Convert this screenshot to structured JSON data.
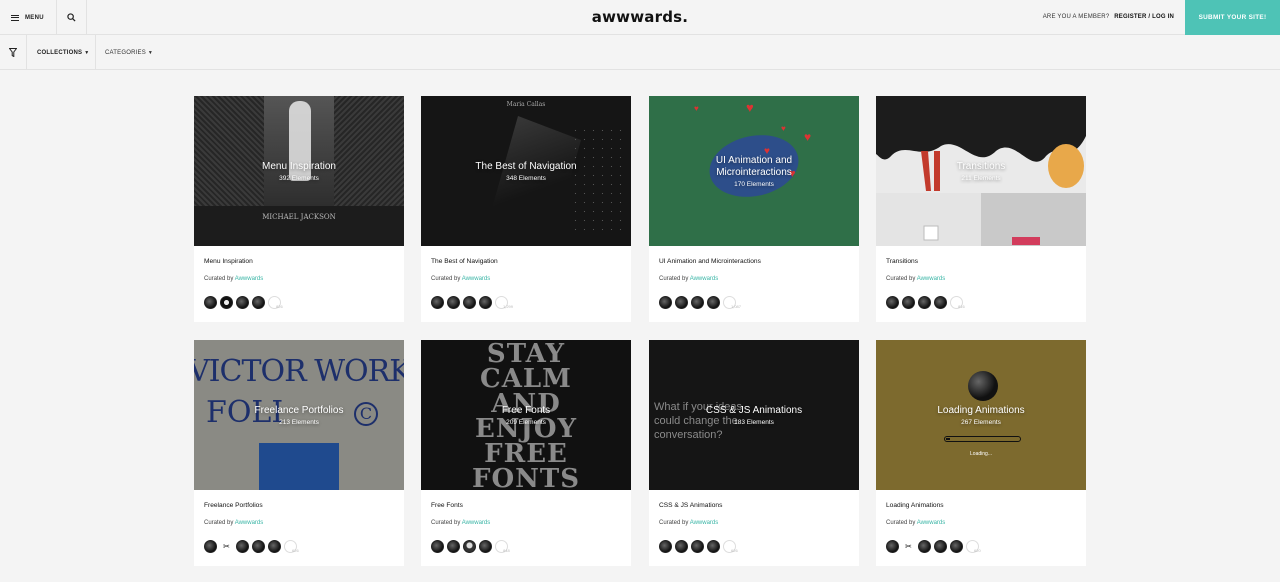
{
  "header": {
    "menu_label": "MENU",
    "logo": "awwwards.",
    "member_question": "ARE YOU A MEMBER?",
    "register_login": "REGISTER / LOG IN",
    "submit_label": "SUBMIT YOUR SITE!"
  },
  "filters": {
    "collections_label": "COLLECTIONS",
    "categories_label": "CATEGORIES"
  },
  "curated_prefix": "Curated by",
  "cards": [
    {
      "title": "Menu Inspiration",
      "count": "392 Elements",
      "name": "Menu Inspiration",
      "curator": "Awwwards",
      "avatar_count": "826",
      "thumb_text": "MICHAEL JACKSON"
    },
    {
      "title": "The Best of Navigation",
      "count": "348 Elements",
      "name": "The Best of Navigation",
      "curator": "Awwwards",
      "avatar_count": "1,299",
      "thumb_text": "Maria Callas"
    },
    {
      "title": "UI Animation and Microinteractions",
      "count": "170 Elements",
      "name": "UI Animation and Microinteractions",
      "curator": "Awwwards",
      "avatar_count": "1,087",
      "thumb_text": ""
    },
    {
      "title": "Transitions",
      "count": "211 Elements",
      "name": "Transitions",
      "curator": "Awwwards",
      "avatar_count": "816",
      "thumb_text": ""
    },
    {
      "title": "Freelance Portfolios",
      "count": "213 Elements",
      "name": "Freelance Portfolios",
      "curator": "Awwwards",
      "avatar_count": "626",
      "thumb_text": "VICTOR WORK"
    },
    {
      "title": "Free Fonts",
      "count": "209 Elements",
      "name": "Free Fonts",
      "curator": "Awwwards",
      "avatar_count": "848",
      "thumb_text": "STAY CALM AND ENJOY FREE FONTS"
    },
    {
      "title": "CSS & JS Animations",
      "count": "183 Elements",
      "name": "CSS & JS Animations",
      "curator": "Awwwards",
      "avatar_count": "626",
      "thumb_text": "What if your ideas could change the conversation?"
    },
    {
      "title": "Loading Animations",
      "count": "267 Elements",
      "name": "Loading Animations",
      "curator": "Awwwards",
      "avatar_count": "620",
      "thumb_text": "Loading..."
    }
  ],
  "colors": {
    "accent": "#4ec3b6",
    "link": "#3ab5a6",
    "background": "#f4f4f4"
  }
}
